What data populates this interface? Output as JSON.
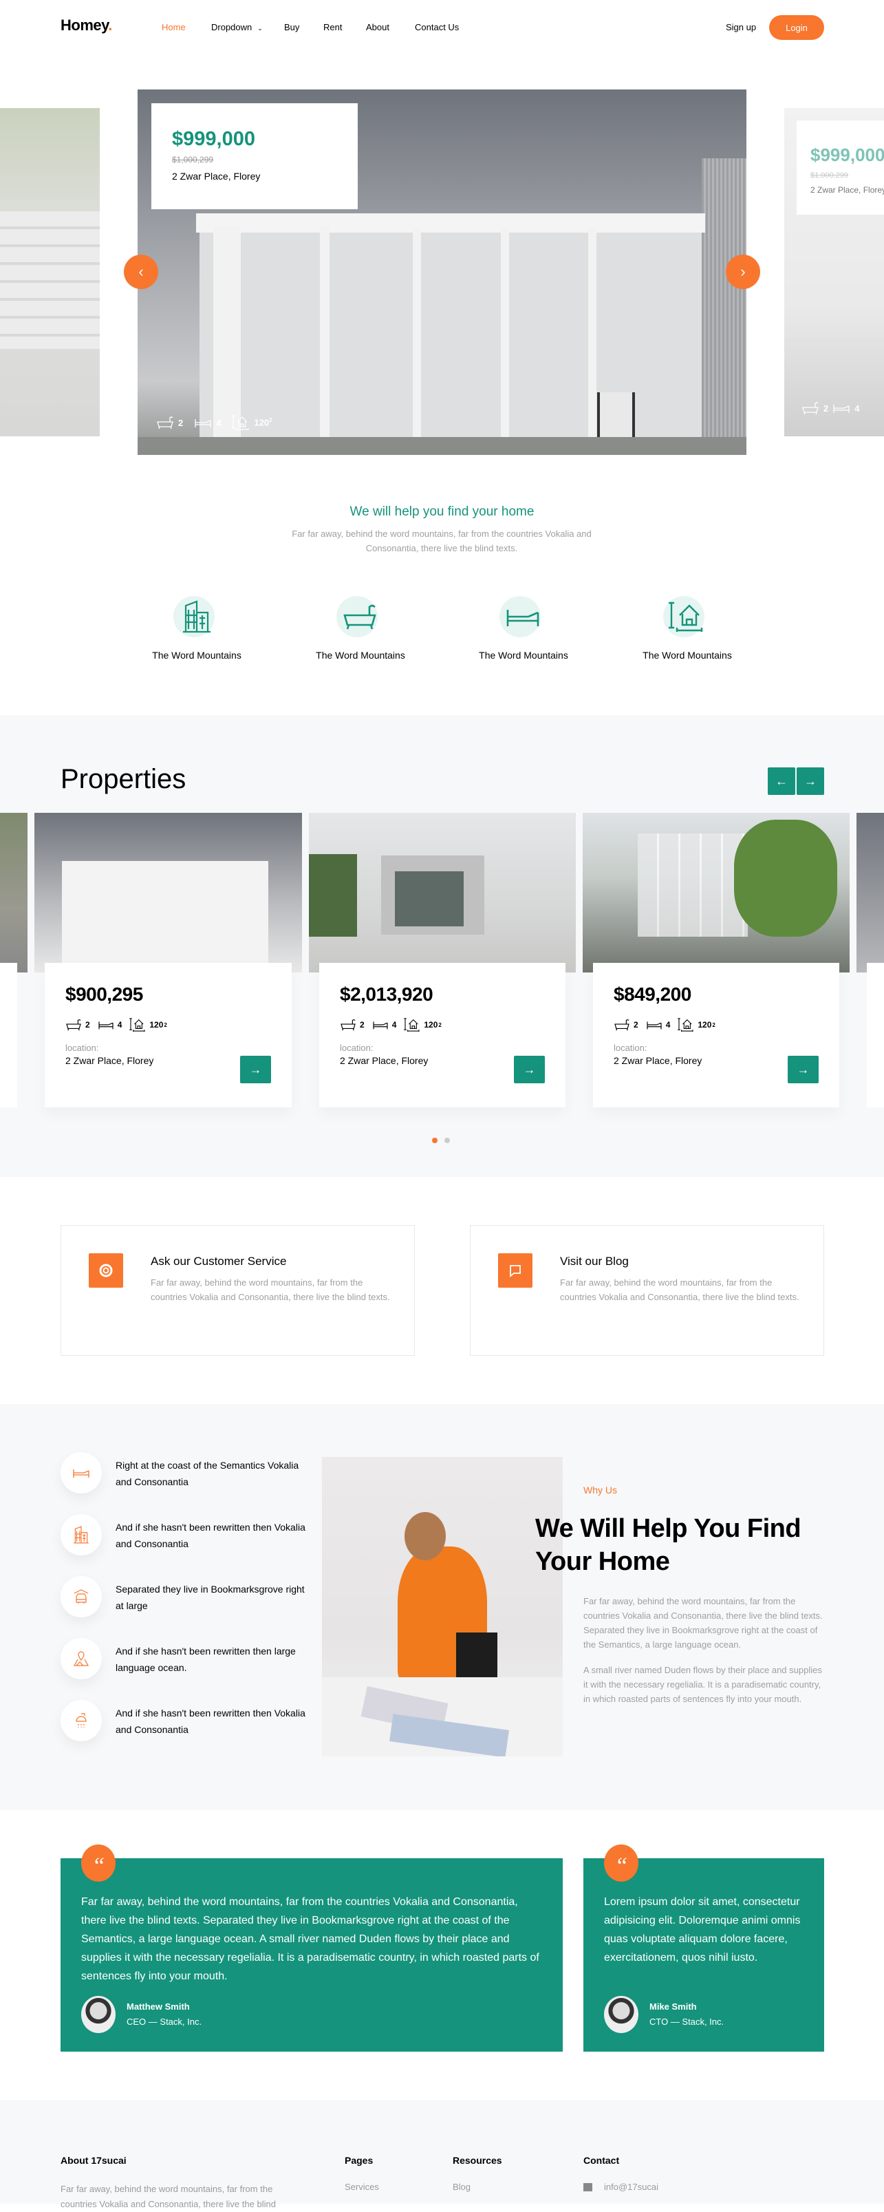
{
  "colors": {
    "brand": "#15937c",
    "accent": "#f8762e",
    "section_bg": "#f7f8fa"
  },
  "nav": {
    "logo": "Homey",
    "logo_dot": ".",
    "links": [
      "Home",
      "Dropdown",
      "Buy",
      "Rent",
      "About",
      "Contact Us"
    ],
    "active": "Home",
    "signup": "Sign up",
    "login": "Login"
  },
  "hero": {
    "slide": {
      "price": "$999,000",
      "old_price": "$1,000,299",
      "address": "2 Zwar Place, Florey",
      "baths": "2",
      "beds": "4",
      "area": "120",
      "area_unit": "2"
    },
    "next_slide": {
      "price": "$999,000",
      "old_price": "$1,000,299",
      "address": "2 Zwar Place, Florey",
      "baths": "2",
      "beds": "4"
    },
    "prev_icon": "chevron-left-icon",
    "next_icon": "chevron-right-icon"
  },
  "intro": {
    "title": "We will help you find your home",
    "text": "Far far away, behind the word mountains, far from the countries Vokalia and Consonantia, there live the blind texts.",
    "features": [
      {
        "icon": "buildings-icon",
        "label": "The Word Mountains"
      },
      {
        "icon": "bathtub-icon",
        "label": "The Word Mountains"
      },
      {
        "icon": "bed-icon",
        "label": "The Word Mountains"
      },
      {
        "icon": "house-area-icon",
        "label": "The Word Mountains"
      }
    ]
  },
  "properties": {
    "title": "Properties",
    "cards": [
      {
        "price": "$900,295",
        "baths": "2",
        "beds": "4",
        "area": "120",
        "area_unit": "2",
        "location_label": "location:",
        "address": "2 Zwar Place, Florey"
      },
      {
        "price": "$2,013,920",
        "baths": "2",
        "beds": "4",
        "area": "120",
        "area_unit": "2",
        "location_label": "location:",
        "address": "2 Zwar Place, Florey"
      },
      {
        "price": "$849,200",
        "baths": "2",
        "beds": "4",
        "area": "120",
        "area_unit": "2",
        "location_label": "location:",
        "address": "2 Zwar Place, Florey"
      }
    ],
    "pages": 2,
    "active_page": 1
  },
  "services": [
    {
      "icon": "lifebuoy-icon",
      "title": "Ask our Customer Service",
      "text": "Far far away, behind the word mountains, far from the countries Vokalia and Consonantia, there live the blind texts."
    },
    {
      "icon": "chat-icon",
      "title": "Visit our Blog",
      "text": "Far far away, behind the word mountains, far from the countries Vokalia and Consonantia, there live the blind texts."
    }
  ],
  "why": {
    "features": [
      {
        "icon": "bed-icon",
        "text": "Right at the coast of the Semantics Vokalia and Consonantia"
      },
      {
        "icon": "buildings-icon",
        "text": "And if she hasn't been rewritten then Vokalia and Consonantia"
      },
      {
        "icon": "car-garage-icon",
        "text": "Separated they live in Bookmarksgrove right at large"
      },
      {
        "icon": "map-pin-icon",
        "text": "And if she hasn't been rewritten then large language ocean."
      },
      {
        "icon": "shower-icon",
        "text": "And if she hasn't been rewritten then Vokalia and Consonantia"
      }
    ],
    "eyebrow": "Why Us",
    "heading": "We Will Help You Find Your Home",
    "paragraphs": [
      "Far far away, behind the word mountains, far from the countries Vokalia and Consonantia, there live the blind texts. Separated they live in Bookmarksgrove right at the coast of the Semantics, a large language ocean.",
      "A small river named Duden flows by their place and supplies it with the necessary regelialia. It is a paradisematic country, in which roasted parts of sentences fly into your mouth."
    ]
  },
  "testimonials": [
    {
      "quote": "Far far away, behind the word mountains, far from the countries Vokalia and Consonantia, there live the blind texts. Separated they live in Bookmarksgrove right at the coast of the Semantics, a large language ocean. A small river named Duden flows by their place and supplies it with the necessary regelialia. It is a paradisematic country, in which roasted parts of sentences fly into your mouth.",
      "name": "Matthew Smith",
      "role": "CEO — Stack, Inc."
    },
    {
      "quote": "Lorem ipsum dolor sit amet, consectetur adipisicing elit. Doloremque animi omnis quas voluptate aliquam dolore facere, exercitationem, quos nihil iusto.",
      "name": "Mike Smith",
      "role": "CTO — Stack, Inc."
    }
  ],
  "footer": {
    "about": {
      "title": "About 17sucai",
      "text": "Far far away, behind the word mountains, far from the countries Vokalia and Consonantia, there live the blind"
    },
    "pages": {
      "title": "Pages",
      "links": [
        "Services"
      ]
    },
    "resources": {
      "title": "Resources",
      "links": [
        "Blog"
      ]
    },
    "contact": {
      "title": "Contact",
      "email": "info@17sucai"
    }
  }
}
